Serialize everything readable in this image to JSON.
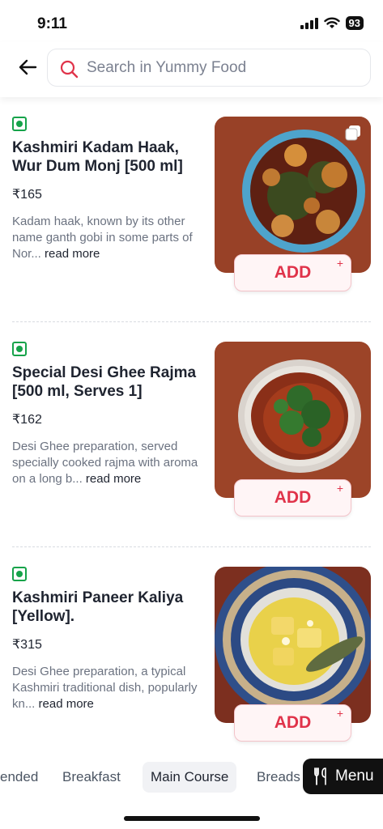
{
  "status_bar": {
    "time": "9:11",
    "battery": "93"
  },
  "search": {
    "placeholder": "Search in Yummy Food"
  },
  "items": [
    {
      "name": "Kashmiri Kadam Haak, Wur Dum Monj [500 ml]",
      "price": "₹165",
      "description": "Kadam haak, known by its other name ganth gobi in some parts of Nor...",
      "read_more": "read more",
      "add_label": "ADD",
      "add_plus": "+"
    },
    {
      "name": "Special Desi Ghee Rajma [500 ml, Serves 1]",
      "price": "₹162",
      "description": "Desi Ghee preparation, served specially cooked rajma with aroma on a long b...",
      "read_more": "read more",
      "add_label": "ADD",
      "add_plus": "+"
    },
    {
      "name": "Kashmiri Paneer Kaliya [Yellow].",
      "price": "₹315",
      "description": "Desi Ghee preparation, a typical Kashmiri traditional dish, popularly kn...",
      "read_more": "read more",
      "add_label": "ADD",
      "add_plus": "+"
    }
  ],
  "categories": [
    "ended",
    "Breakfast",
    "Main Course",
    "Breads"
  ],
  "active_category": "Main Course",
  "menu_button": {
    "label": "Menu",
    "icon": "fork-knife-icon"
  },
  "colors": {
    "accent": "#e0334a",
    "veg": "#16a34a",
    "menu_bg": "#111111"
  }
}
